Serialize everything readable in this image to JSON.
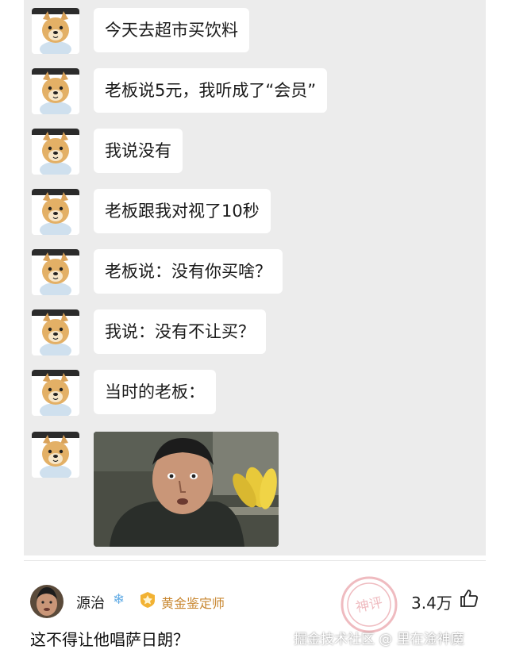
{
  "chat": {
    "messages": [
      {
        "text": "今天去超市买饮料"
      },
      {
        "text": "老板说5元，我听成了“会员”"
      },
      {
        "text": "我说没有"
      },
      {
        "text": "老板跟我对视了10秒"
      },
      {
        "text": "老板说：没有你买啥？"
      },
      {
        "text": "我说：没有不让买？"
      },
      {
        "text": "当时的老板："
      }
    ],
    "image_message": {
      "kind": "photo"
    }
  },
  "comment": {
    "username": "源治",
    "user_icon": "snowflake-icon",
    "badge": "黄金鉴定师",
    "badge_icon": "gold-medal-icon",
    "likes": "3.4万",
    "like_icon": "thumbs-up-icon",
    "text": "这不得让他唱萨日朗？",
    "stamp_text": "神评"
  },
  "watermark": "掘金技术社区 @ 里在淦神魔",
  "colors": {
    "chat_bg": "#ececec",
    "bubble_bg": "#ffffff",
    "badge": "#c8862f",
    "stamp": "#e07a82"
  }
}
